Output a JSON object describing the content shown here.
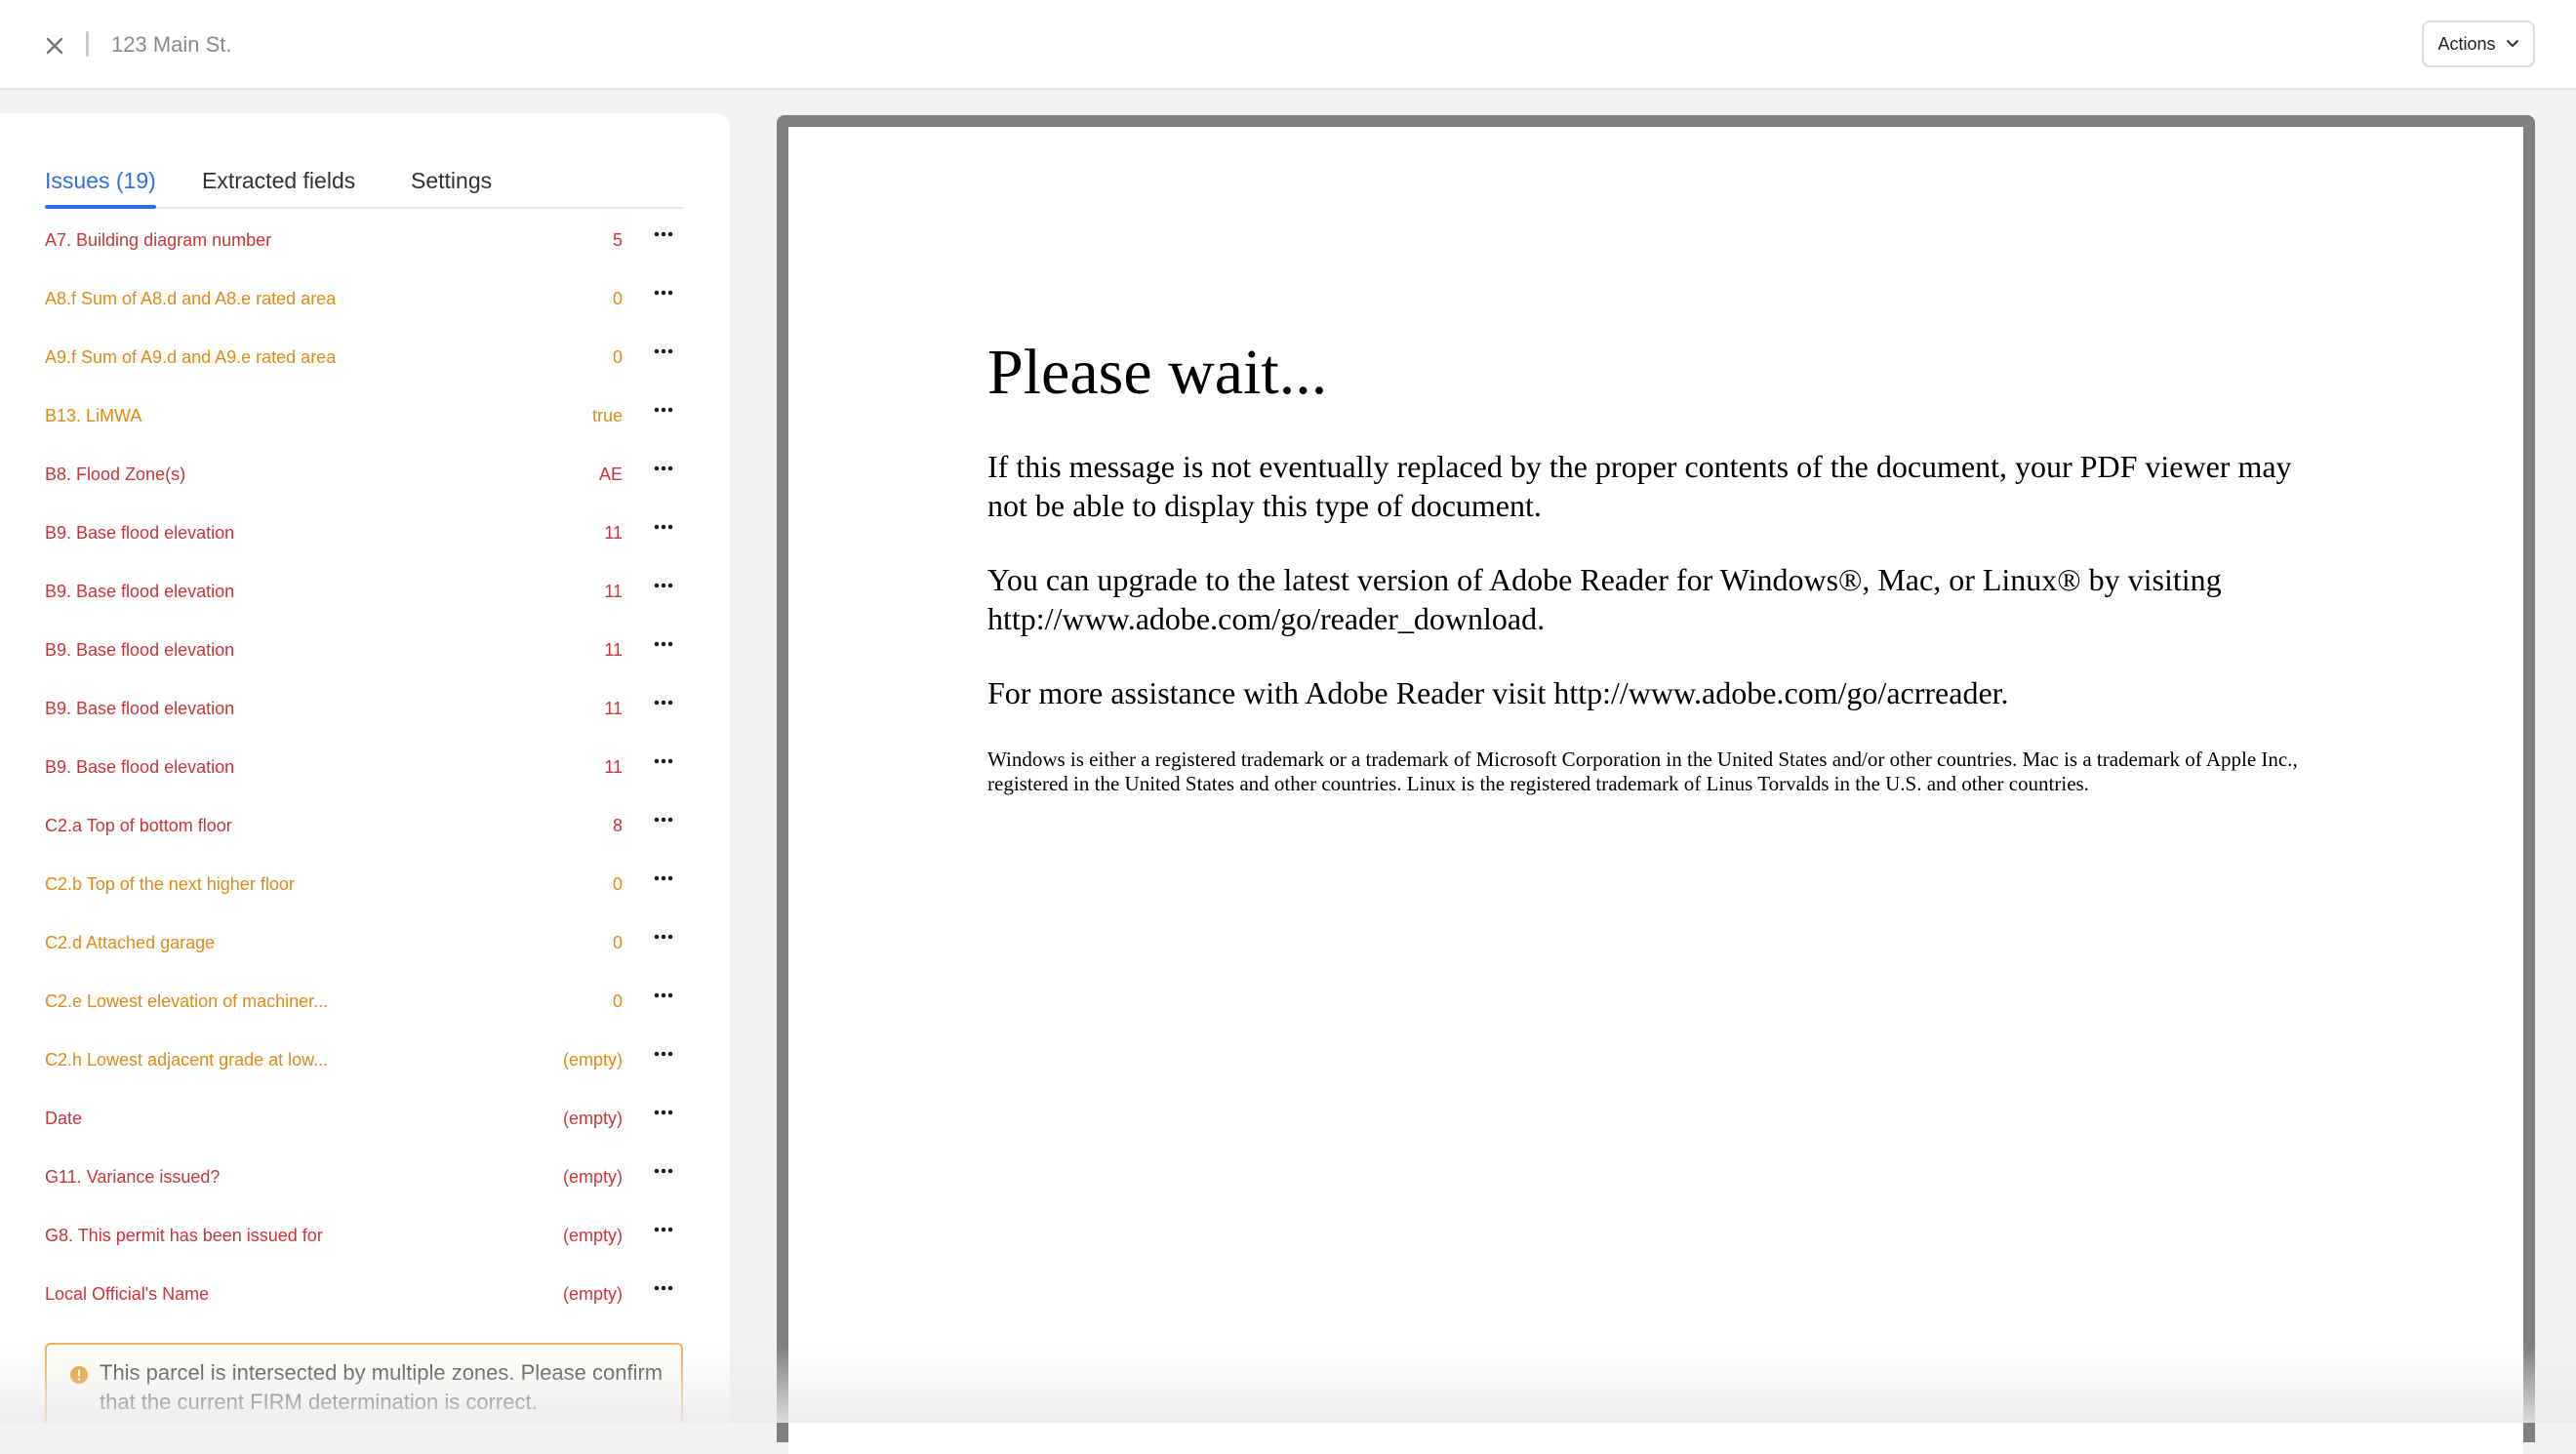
{
  "header": {
    "address": "123 Main St.",
    "actions_label": "Actions"
  },
  "tabs": [
    {
      "label": "Issues (19)",
      "active": true
    },
    {
      "label": "Extracted fields",
      "active": false
    },
    {
      "label": "Settings",
      "active": false
    }
  ],
  "issues": [
    {
      "label": "A7. Building diagram number",
      "value": "5",
      "severity": "red"
    },
    {
      "label": "A8.f Sum of A8.d and A8.e rated area",
      "value": "0",
      "severity": "orange"
    },
    {
      "label": "A9.f Sum of A9.d and A9.e rated area",
      "value": "0",
      "severity": "orange"
    },
    {
      "label": "B13. LiMWA",
      "value": "true",
      "severity": "orange"
    },
    {
      "label": "B8. Flood Zone(s)",
      "value": "AE",
      "severity": "red"
    },
    {
      "label": "B9. Base flood elevation",
      "value": "11",
      "severity": "red"
    },
    {
      "label": "B9. Base flood elevation",
      "value": "11",
      "severity": "red"
    },
    {
      "label": "B9. Base flood elevation",
      "value": "11",
      "severity": "red"
    },
    {
      "label": "B9. Base flood elevation",
      "value": "11",
      "severity": "red"
    },
    {
      "label": "B9. Base flood elevation",
      "value": "11",
      "severity": "red"
    },
    {
      "label": "C2.a Top of bottom floor",
      "value": "8",
      "severity": "red"
    },
    {
      "label": "C2.b Top of the next higher floor",
      "value": "0",
      "severity": "orange"
    },
    {
      "label": "C2.d Attached garage",
      "value": "0",
      "severity": "orange"
    },
    {
      "label": "C2.e Lowest elevation of machiner...",
      "value": "0",
      "severity": "orange"
    },
    {
      "label": "C2.h Lowest adjacent grade at low...",
      "value": "(empty)",
      "severity": "orange"
    },
    {
      "label": "Date",
      "value": "(empty)",
      "severity": "red"
    },
    {
      "label": "G11. Variance issued?",
      "value": "(empty)",
      "severity": "red"
    },
    {
      "label": "G8. This permit has been issued for",
      "value": "(empty)",
      "severity": "red"
    },
    {
      "label": "Local Official's Name",
      "value": "(empty)",
      "severity": "red"
    }
  ],
  "warning": {
    "text": "This parcel is intersected by multiple zones. Please confirm that the current FIRM determination is correct."
  },
  "document": {
    "title": "Please wait...",
    "para1": "If this message is not eventually replaced by the proper contents of the document, your PDF viewer may not be able to display this type of document.",
    "para2": "You can upgrade to the latest version of Adobe Reader for Windows®, Mac, or Linux® by visiting  http://www.adobe.com/go/reader_download.",
    "para3": "For more assistance with Adobe Reader visit  http://www.adobe.com/go/acrreader.",
    "trademark": "Windows is either a registered trademark or a trademark of Microsoft Corporation in the United States and/or other countries. Mac is a trademark of Apple Inc., registered in the United States and other countries. Linux is the registered trademark of Linus Torvalds in the U.S. and other countries."
  },
  "colors": {
    "accent": "#2f6fe4",
    "severity_red": "#c8363a",
    "severity_orange": "#de8a16",
    "warning_border": "#f0b25a"
  },
  "icons": {
    "close": "close-icon",
    "dropdown": "chevron-down-icon",
    "more": "more-horizontal-icon",
    "warning": "warning-circle-icon"
  }
}
